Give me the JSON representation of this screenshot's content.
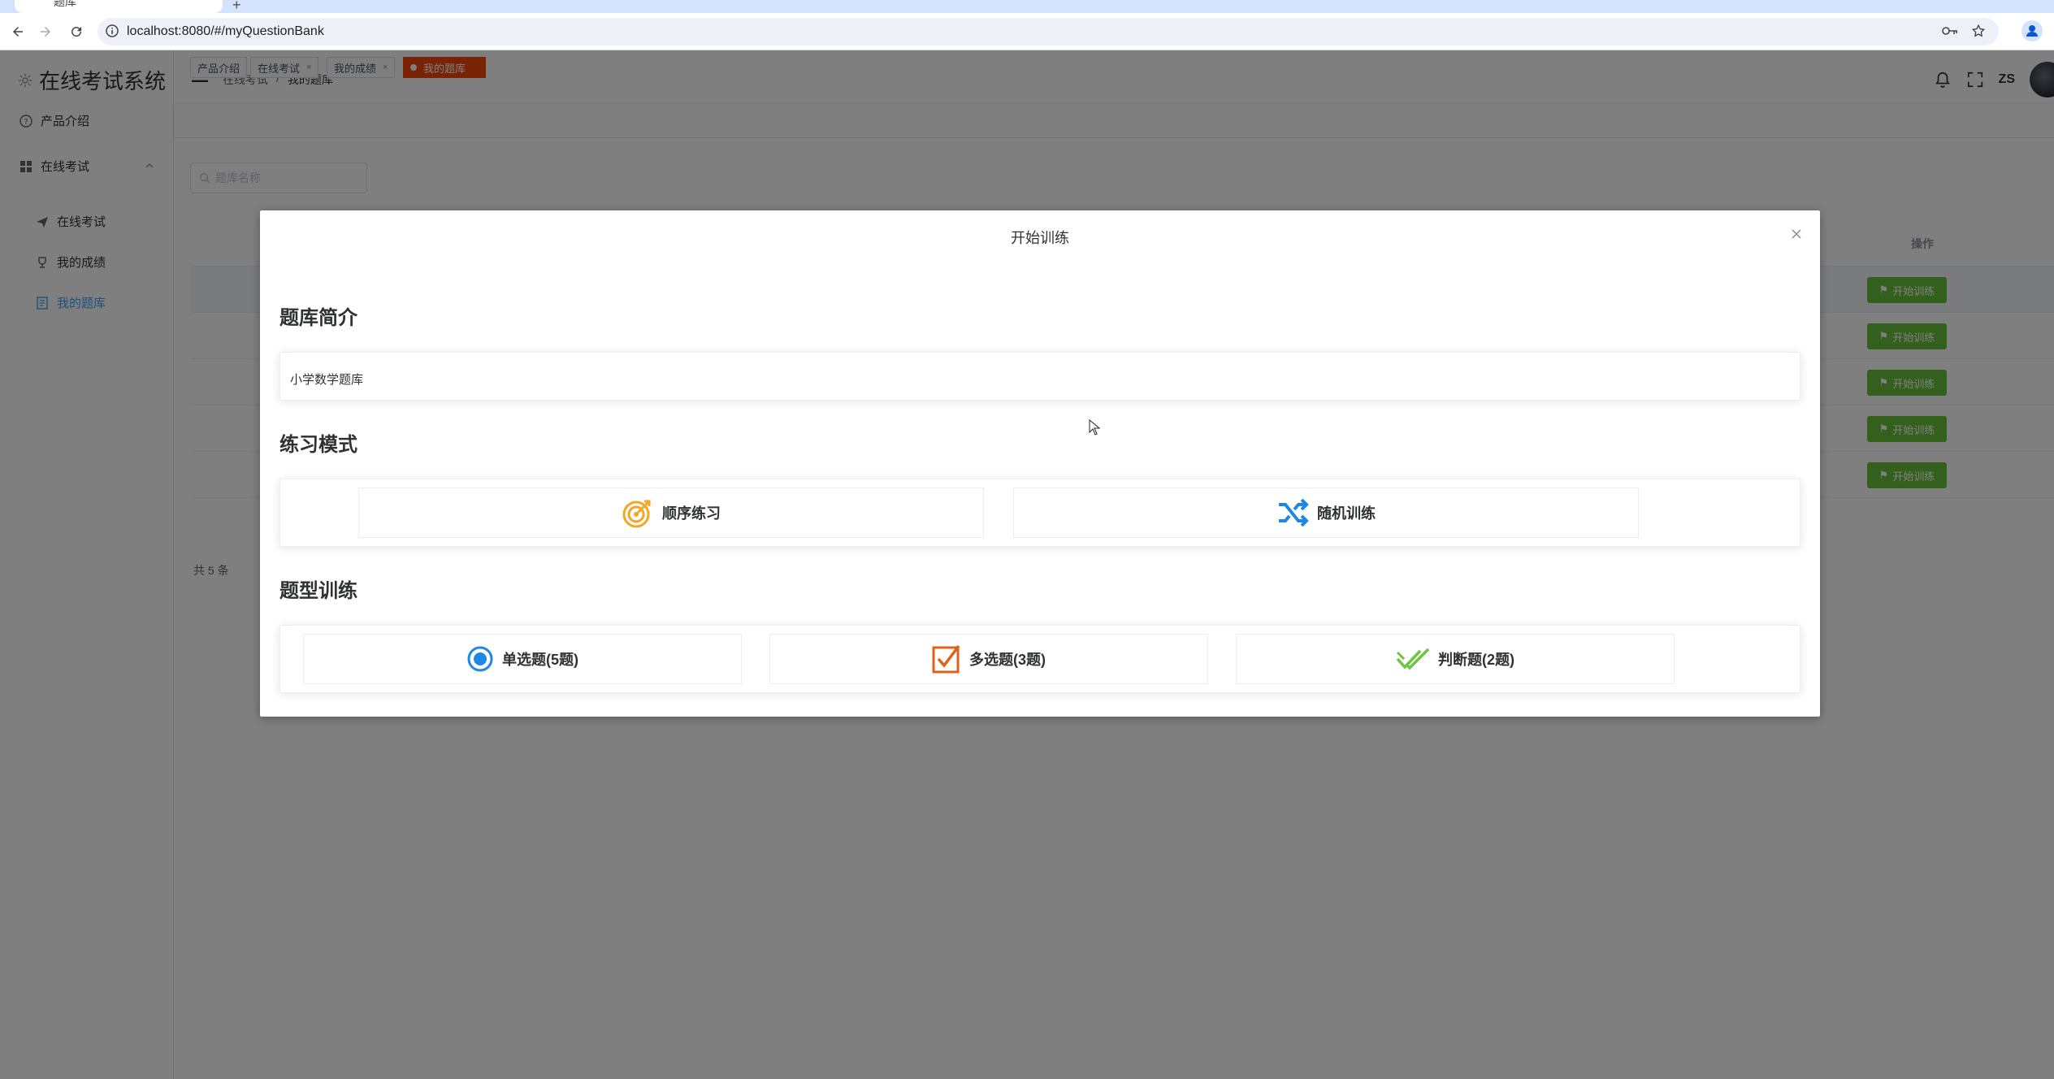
{
  "browser": {
    "tab_title": "题库",
    "url": "localhost:8080/#/myQuestionBank"
  },
  "sidebar": {
    "brand": "在线考试系统",
    "items": [
      {
        "label": "产品介绍"
      },
      {
        "label": "在线考试"
      },
      {
        "label": "在线考试"
      },
      {
        "label": "我的成绩"
      },
      {
        "label": "我的题库"
      }
    ]
  },
  "header": {
    "breadcrumb": [
      "在线考试",
      "/",
      "我的题库"
    ],
    "username": "ZS"
  },
  "tags": [
    "产品介绍",
    "在线考试",
    "我的成绩",
    "我的题库"
  ],
  "content": {
    "search_placeholder": "题库名称",
    "column_action": "操作",
    "row_button": "开始训练",
    "pager_total": "共 5 条"
  },
  "dialog": {
    "title": "开始训练",
    "intro_heading": "题库简介",
    "intro_text": "小学数学题库",
    "mode_heading": "练习模式",
    "modes": [
      "顺序练习",
      "随机训练"
    ],
    "type_heading": "题型训练",
    "types": [
      "单选题(5题)",
      "多选题(3题)",
      "判断题(2题)"
    ]
  },
  "colors": {
    "accent_blue": "#409eff",
    "success_green": "#67c23a",
    "tag_active": "#f0470c",
    "sequential_icon": "#f5a623",
    "random_icon": "#1e88e5",
    "multi_icon": "#e0621a",
    "judge_icon": "#6cc644"
  }
}
